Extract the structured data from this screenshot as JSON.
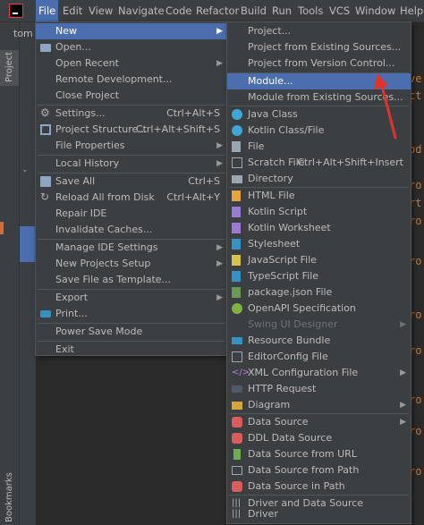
{
  "menubar": {
    "items": [
      "File",
      "Edit",
      "View",
      "Navigate",
      "Code",
      "Refactor",
      "Build",
      "Run",
      "Tools",
      "VCS",
      "Window",
      "Help"
    ]
  },
  "sidebar": {
    "project_label": "Project",
    "bookmarks_label": "Bookmarks",
    "tab_fragment": "tom"
  },
  "editor": {
    "fragments": [
      "ve",
      "ct",
      "od",
      "ro",
      "rt",
      "ro",
      "ro",
      "ro",
      "ro",
      "ro",
      "ro",
      "ro"
    ]
  },
  "file_menu": {
    "new": "New",
    "open": "Open...",
    "open_recent": "Open Recent",
    "remote_development": "Remote Development...",
    "close_project": "Close Project",
    "settings": "Settings...",
    "settings_shortcut": "Ctrl+Alt+S",
    "project_structure": "Project Structure...",
    "project_structure_shortcut": "Ctrl+Alt+Shift+S",
    "file_properties": "File Properties",
    "local_history": "Local History",
    "save_all": "Save All",
    "save_all_shortcut": "Ctrl+S",
    "reload": "Reload All from Disk",
    "reload_shortcut": "Ctrl+Alt+Y",
    "repair_ide": "Repair IDE",
    "invalidate_caches": "Invalidate Caches...",
    "manage_ide_settings": "Manage IDE Settings",
    "new_projects_setup": "New Projects Setup",
    "save_file_as_template": "Save File as Template...",
    "export": "Export",
    "print": "Print...",
    "power_save_mode": "Power Save Mode",
    "exit": "Exit"
  },
  "new_menu": {
    "project": "Project...",
    "project_existing": "Project from Existing Sources...",
    "project_vcs": "Project from Version Control...",
    "module": "Module...",
    "module_existing": "Module from Existing Sources...",
    "java_class": "Java Class",
    "kotlin_class": "Kotlin Class/File",
    "file": "File",
    "scratch_file": "Scratch File",
    "scratch_shortcut": "Ctrl+Alt+Shift+Insert",
    "directory": "Directory",
    "html_file": "HTML File",
    "kotlin_script": "Kotlin Script",
    "kotlin_worksheet": "Kotlin Worksheet",
    "stylesheet": "Stylesheet",
    "javascript_file": "JavaScript File",
    "typescript_file": "TypeScript File",
    "package_json": "package.json File",
    "openapi": "OpenAPI Specification",
    "swing_ui": "Swing UI Designer",
    "resource_bundle": "Resource Bundle",
    "editorconfig": "EditorConfig File",
    "xml_config": "XML Configuration File",
    "http_request": "HTTP Request",
    "diagram": "Diagram",
    "data_source": "Data Source",
    "ddl_data_source": "DDL Data Source",
    "data_source_url": "Data Source from URL",
    "data_source_path": "Data Source from Path",
    "data_source_in_path": "Data Source in Path",
    "driver_and_data_source": "Driver and Data Source",
    "driver": "Driver"
  },
  "colors": {
    "highlight": "#4b6eaf",
    "menu_bg": "#3c3f41",
    "annotation": "#e0342b"
  }
}
